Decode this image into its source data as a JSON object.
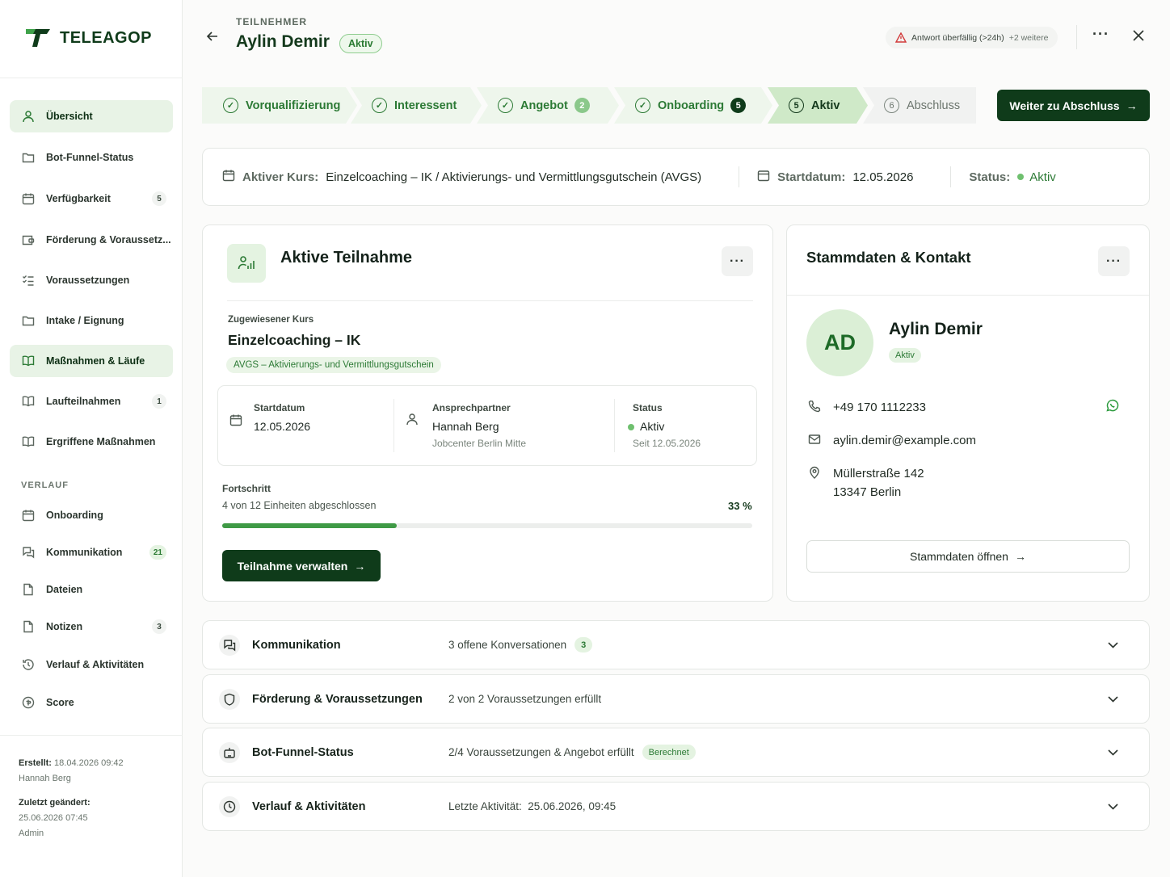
{
  "app": {
    "name": "TELEAGOP"
  },
  "sidebar": {
    "items": [
      {
        "label": "Übersicht",
        "icon": "user-icon",
        "active": true,
        "badge": ""
      },
      {
        "label": "Bot-Funnel-Status",
        "icon": "folder-icon",
        "badge": ""
      },
      {
        "label": "Verfügbarkeit",
        "icon": "calendar-icon",
        "badge": "5"
      },
      {
        "label": "Förderung & Voraussetz...",
        "icon": "wallet-icon",
        "badge": ""
      },
      {
        "label": "Voraussetzungen",
        "icon": "checklist-icon",
        "badge": ""
      },
      {
        "label": "Intake / Eignung",
        "icon": "folder-icon",
        "badge": ""
      },
      {
        "label": "Maßnahmen & Läufe",
        "icon": "book-icon",
        "active": true,
        "badge": ""
      },
      {
        "label": "Laufteilnahmen",
        "icon": "book-icon",
        "badge": "1"
      },
      {
        "label": "Ergriffene Maßnahmen",
        "icon": "book-icon",
        "badge": ""
      }
    ],
    "section_label": "VERLAUF",
    "verlauf_items": [
      {
        "label": "Onboarding",
        "icon": "calendar-icon",
        "badge": ""
      },
      {
        "label": "Kommunikation",
        "icon": "chat-icon",
        "badge": "21"
      },
      {
        "label": "Dateien",
        "icon": "file-icon",
        "badge": ""
      },
      {
        "label": "Notizen",
        "icon": "note-icon",
        "badge": "3"
      },
      {
        "label": "Verlauf & Aktivitäten",
        "icon": "history-icon",
        "badge": ""
      },
      {
        "label": "Score",
        "icon": "score-icon",
        "badge": ""
      }
    ],
    "meta": {
      "created_label": "Erstellt:",
      "created_value": "18.04.2026 09:42",
      "created_by": "Hannah Berg",
      "changed_label": "Zuletzt geändert:",
      "changed_value": "25.06.2026 07:45",
      "changed_by": "Admin"
    }
  },
  "header": {
    "kicker": "TEILNEHMER",
    "name": "Aylin Demir",
    "status": "Aktiv",
    "alert": "Antwort überfällig (>24h)",
    "alert_more": "+2 weitere"
  },
  "stepper": {
    "steps": [
      {
        "label": "Vorqualifizierung",
        "state": "done",
        "count": ""
      },
      {
        "label": "Interessent",
        "state": "done",
        "count": ""
      },
      {
        "label": "Angebot",
        "state": "done",
        "count": "2"
      },
      {
        "label": "Onboarding",
        "state": "done",
        "count": "5"
      },
      {
        "label": "Aktiv",
        "state": "current",
        "num": "5",
        "count": ""
      },
      {
        "label": "Abschluss",
        "state": "future",
        "num": "6",
        "count": ""
      }
    ],
    "next_button": "Weiter zu Abschluss"
  },
  "course_bar": {
    "course_label": "Aktiver Kurs:",
    "course_value": "Einzelcoaching – IK / Aktivierungs- und Vermittlungsgutschein (AVGS)",
    "start_label": "Startdatum:",
    "start_value": "12.05.2026",
    "status_label": "Status:",
    "status_value": "Aktiv"
  },
  "participation": {
    "title": "Aktive Teilnahme",
    "assigned_label": "Zugewiesener Kurs",
    "course_name": "Einzelcoaching – IK",
    "course_tag": "AVGS – Aktivierungs- und Vermittlungsgutschein",
    "start_label": "Startdatum",
    "start_value": "12.05.2026",
    "contact_label": "Ansprechpartner",
    "contact_name": "Hannah Berg",
    "contact_org": "Jobcenter Berlin Mitte",
    "status_label": "Status",
    "status_value": "Aktiv",
    "status_since": "Seit 12.05.2026",
    "progress_label": "Fortschritt",
    "progress_text": "4 von 12 Einheiten abgeschlossen",
    "progress_pct_text": "33 %",
    "progress_fraction": 0.33,
    "manage_button": "Teilnahme verwalten"
  },
  "contact": {
    "title": "Stammdaten & Kontakt",
    "initials": "AD",
    "name": "Aylin Demir",
    "status": "Aktiv",
    "phone": "+49 170 1112233",
    "email": "aylin.demir@example.com",
    "street": "Müllerstraße 142",
    "city": "13347 Berlin",
    "open_button": "Stammdaten öffnen"
  },
  "accordions": [
    {
      "title": "Kommunikation",
      "summary": "3 offene Konversationen",
      "tag": "3",
      "icon": "chat-icon"
    },
    {
      "title": "Förderung & Voraussetzungen",
      "summary": "2 von 2 Voraussetzungen erfüllt",
      "tag": "",
      "icon": "shield-icon"
    },
    {
      "title": "Bot-Funnel-Status",
      "summary": "2/4 Voraussetzungen & Angebot erfüllt",
      "tag": "Berechnet",
      "icon": "bot-icon"
    },
    {
      "title": "Verlauf & Aktivitäten",
      "summary": "Letzte Aktivität:  25.06.2026, 09:45",
      "tag": "",
      "icon": "clock-icon"
    }
  ],
  "colors": {
    "brand": "#0f3b1a",
    "accent": "#2c7a35",
    "accent_light": "#e4f3e1"
  }
}
